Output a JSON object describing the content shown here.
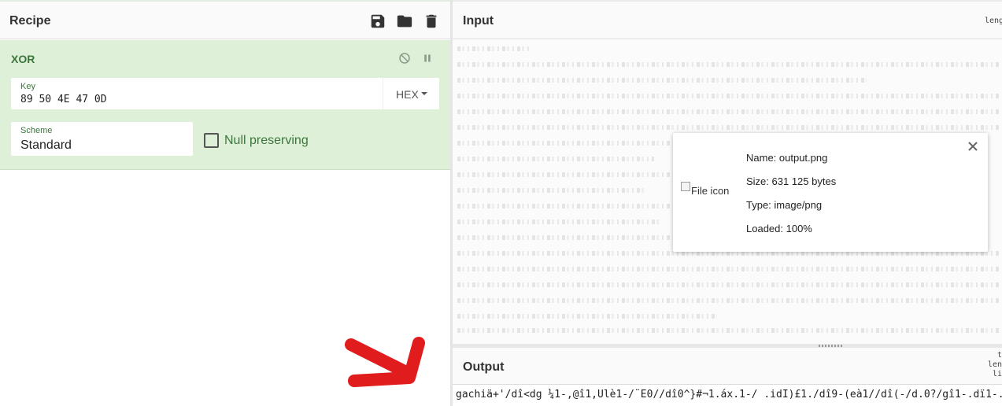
{
  "recipe": {
    "title": "Recipe",
    "actions": [
      {
        "name": "save-icon"
      },
      {
        "name": "folder-icon"
      },
      {
        "name": "trash-icon"
      }
    ]
  },
  "operation": {
    "name": "XOR",
    "disable_icon": "disable-icon",
    "pause_icon": "pause-icon",
    "key": {
      "label": "Key",
      "value": "89 50 4E 47 0D",
      "format": "HEX"
    },
    "scheme": {
      "label": "Scheme",
      "value": "Standard"
    },
    "null_preserving": {
      "label": "Null preserving",
      "checked": false
    }
  },
  "input": {
    "title": "Input",
    "stats": "leng"
  },
  "file_details": {
    "icon_alt": "File icon",
    "name": "Name: output.png",
    "size": "Size: 631 125 bytes",
    "type": "Type: image/png",
    "loaded": "Loaded: 100%"
  },
  "output": {
    "title": "Output",
    "stats": [
      "t",
      "len",
      "li"
    ],
    "text": "gachiä+'/dî<dg ¼1-,@î1,Ûlè1-/¨E0//dî0^}#¬1.áx.1-/ .idI)£1./dî9-(eà1//dî(-/d.0?/gî1-.dï1-.~"
  },
  "colors": {
    "operation_bg": "#dff0d8",
    "operation_text": "#3c763d",
    "arrow": "#e01c1c"
  }
}
